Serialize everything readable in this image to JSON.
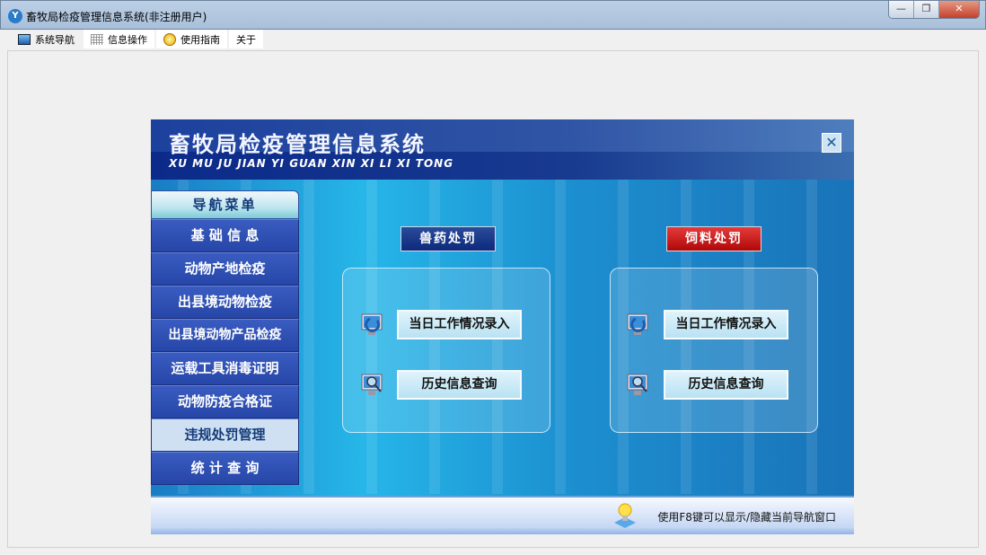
{
  "window": {
    "title": "畜牧局检疫管理信息系统(非注册用户)",
    "app_icon": "Y",
    "minimize": "—",
    "restore": "❐",
    "close": "✕"
  },
  "menu": [
    {
      "label": "系统导航",
      "icon": "window-icon"
    },
    {
      "label": "信息操作",
      "icon": "grid-icon"
    },
    {
      "label": "使用指南",
      "icon": "help-icon"
    },
    {
      "label": "关于"
    }
  ],
  "panel": {
    "title": "畜牧局检疫管理信息系统",
    "subtitle": "XU MU JU JIAN YI GUAN  XIN XI LI XI TONG",
    "close": "✕"
  },
  "nav": {
    "header": "导航菜单",
    "items": [
      "基 础 信 息",
      "动物产地检疫",
      "出县境动物检疫",
      "出县境动物产品检疫",
      "运载工具消毒证明",
      "动物防疫合格证",
      "违规处罚管理",
      "统 计 查 询"
    ],
    "selected_index": 6
  },
  "sections": [
    {
      "title": "兽药处罚",
      "color": "#0d2a7c",
      "entry": "当日工作情况录入",
      "query": "历史信息查询"
    },
    {
      "title": "饲料处罚",
      "color": "#c01010",
      "entry": "当日工作情况录入",
      "query": "历史信息查询"
    }
  ],
  "footer": {
    "hint": "使用F8键可以显示/隐藏当前导航窗口"
  }
}
